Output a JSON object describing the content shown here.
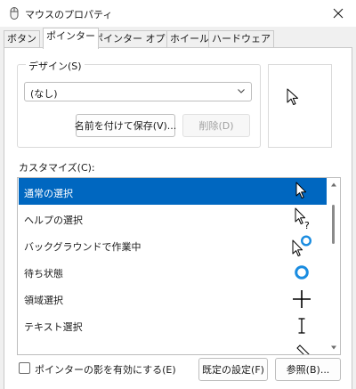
{
  "window": {
    "title": "マウスのプロパティ",
    "close_glyph": "✕"
  },
  "tabs": [
    {
      "label": "ボタン",
      "active": false
    },
    {
      "label": "ポインター",
      "active": true
    },
    {
      "label": "ポインター オプション",
      "active": false
    },
    {
      "label": "ホイール",
      "active": false
    },
    {
      "label": "ハードウェア",
      "active": false
    }
  ],
  "design": {
    "label": "デザイン(S)",
    "selected": "(なし)",
    "save_label": "名前を付けて保存(V)...",
    "delete_label": "削除(D)"
  },
  "customize": {
    "label": "カスタマイズ(C):",
    "items": [
      {
        "label": "通常の選択",
        "icon": "arrow-cursor-icon",
        "selected": true
      },
      {
        "label": "ヘルプの選択",
        "icon": "help-cursor-icon",
        "selected": false
      },
      {
        "label": "バックグラウンドで作業中",
        "icon": "working-in-background-cursor-icon",
        "selected": false
      },
      {
        "label": "待ち状態",
        "icon": "busy-cursor-icon",
        "selected": false
      },
      {
        "label": "領域選択",
        "icon": "precision-select-cursor-icon",
        "selected": false
      },
      {
        "label": "テキスト選択",
        "icon": "text-select-cursor-icon",
        "selected": false
      }
    ]
  },
  "options": {
    "shadow_label": "ポインターの影を有効にする(E)",
    "shadow_checked": false,
    "default_label": "既定の設定(F)",
    "browse_label": "参照(B)..."
  },
  "colors": {
    "accent": "#0067c0",
    "busy_ring": "#1a8ce0"
  }
}
